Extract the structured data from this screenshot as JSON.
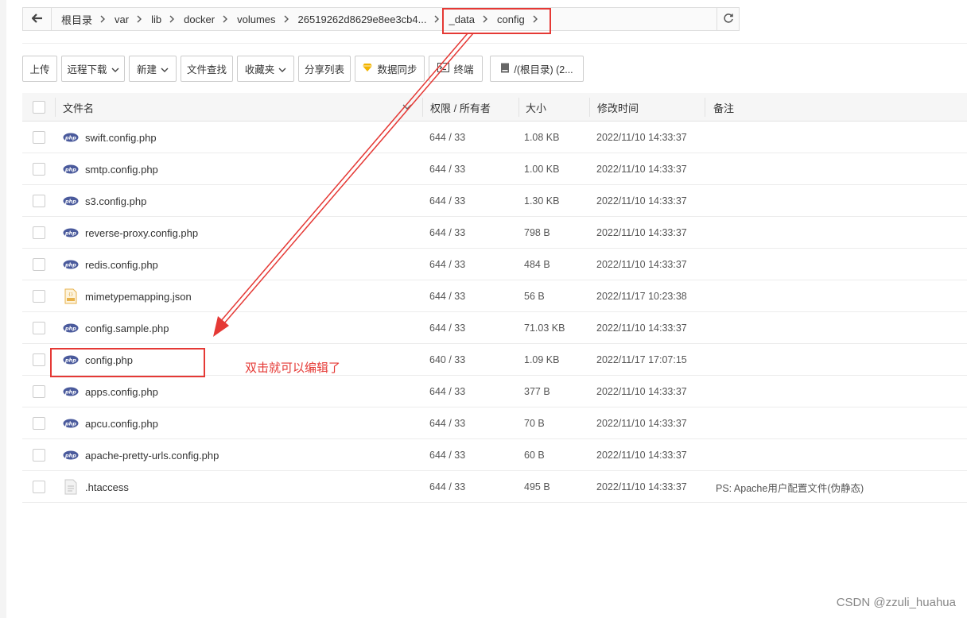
{
  "breadcrumbs": [
    "根目录",
    "var",
    "lib",
    "docker",
    "volumes",
    "26519262d8629e8ee3cb4...",
    "_data",
    "config"
  ],
  "toolbar": {
    "upload": "上传",
    "remote_download": "远程下载",
    "new": "新建",
    "file_search": "文件查找",
    "favorites": "收藏夹",
    "share_list": "分享列表",
    "data_sync": "数据同步",
    "terminal": "终端",
    "disk": "/(根目录) (2..."
  },
  "table": {
    "headers": {
      "name": "文件名",
      "perm": "权限 / 所有者",
      "size": "大小",
      "mtime": "修改时间",
      "note": "备注"
    },
    "rows": [
      {
        "name": "swift.config.php",
        "icon": "php-icon",
        "perm": "644 / 33",
        "size": "1.08 KB",
        "mtime": "2022/11/10 14:33:37",
        "note": ""
      },
      {
        "name": "smtp.config.php",
        "icon": "php-icon",
        "perm": "644 / 33",
        "size": "1.00 KB",
        "mtime": "2022/11/10 14:33:37",
        "note": ""
      },
      {
        "name": "s3.config.php",
        "icon": "php-icon",
        "perm": "644 / 33",
        "size": "1.30 KB",
        "mtime": "2022/11/10 14:33:37",
        "note": ""
      },
      {
        "name": "reverse-proxy.config.php",
        "icon": "php-icon",
        "perm": "644 / 33",
        "size": "798 B",
        "mtime": "2022/11/10 14:33:37",
        "note": ""
      },
      {
        "name": "redis.config.php",
        "icon": "php-icon",
        "perm": "644 / 33",
        "size": "484 B",
        "mtime": "2022/11/10 14:33:37",
        "note": ""
      },
      {
        "name": "mimetypemapping.json",
        "icon": "json-icon",
        "perm": "644 / 33",
        "size": "56 B",
        "mtime": "2022/11/17 10:23:38",
        "note": ""
      },
      {
        "name": "config.sample.php",
        "icon": "php-icon",
        "perm": "644 / 33",
        "size": "71.03 KB",
        "mtime": "2022/11/10 14:33:37",
        "note": ""
      },
      {
        "name": "config.php",
        "icon": "php-icon",
        "perm": "640 / 33",
        "size": "1.09 KB",
        "mtime": "2022/11/17 17:07:15",
        "note": ""
      },
      {
        "name": "apps.config.php",
        "icon": "php-icon",
        "perm": "644 / 33",
        "size": "377 B",
        "mtime": "2022/11/10 14:33:37",
        "note": ""
      },
      {
        "name": "apcu.config.php",
        "icon": "php-icon",
        "perm": "644 / 33",
        "size": "70 B",
        "mtime": "2022/11/10 14:33:37",
        "note": ""
      },
      {
        "name": "apache-pretty-urls.config.php",
        "icon": "php-icon",
        "perm": "644 / 33",
        "size": "60 B",
        "mtime": "2022/11/10 14:33:37",
        "note": ""
      },
      {
        "name": ".htaccess",
        "icon": "text-file-icon",
        "perm": "644 / 33",
        "size": "495 B",
        "mtime": "2022/11/10 14:33:37",
        "note": "PS: Apache用户配置文件(伪静态)"
      }
    ]
  },
  "annotation": {
    "text": "双击就可以编辑了",
    "color": "#e53935"
  },
  "watermark": "CSDN @zzuli_huahua",
  "colors": {
    "php_badge": "#4a5a9c",
    "json_badge": "#e8b24a",
    "data_sync_icon": "#f2b400"
  }
}
